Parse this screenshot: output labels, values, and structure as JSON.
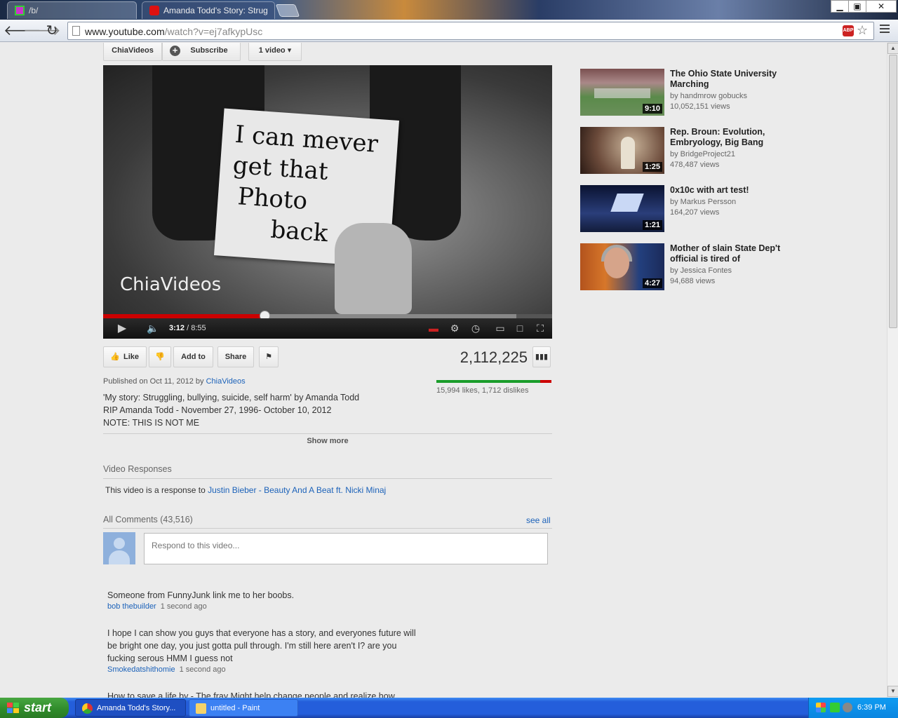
{
  "browser": {
    "tabs": [
      {
        "label": "/b/"
      },
      {
        "label": "Amanda Todd's Story: Strug"
      }
    ],
    "url_domain": "www.youtube.com",
    "url_path": "/watch?v=ej7afkypUsc",
    "window_buttons": {
      "minimize": "▁",
      "maximize": "▣",
      "close": "✕"
    }
  },
  "channel": {
    "name": "ChiaVideos",
    "subscribe_label": "Subscribe",
    "video_count_label": "1 video ▾"
  },
  "player": {
    "card_lines": [
      "I can mever",
      "get that",
      "Photo",
      "back"
    ],
    "watermark": "ChiaVideos",
    "current_time": "3:12",
    "duration": "/ 8:55",
    "played_fraction": 0.36,
    "buffered_fraction": 0.92
  },
  "actions": {
    "like_label": "Like",
    "add_to_label": "Add to",
    "share_label": "Share"
  },
  "stats": {
    "view_count": "2,112,225",
    "likes_text": "15,994 likes, 1,712 dislikes",
    "like_fraction": 0.903
  },
  "description": {
    "published_prefix": "Published on Oct 11, 2012 by",
    "published_by": "ChiaVideos",
    "lines": [
      "'My story: Struggling, bullying, suicide, self harm' by Amanda Todd",
      "RIP Amanda Todd - November 27, 1996- October 10, 2012",
      "NOTE: THIS IS NOT ME"
    ],
    "show_more_label": "Show more"
  },
  "responses": {
    "title": "Video Responses",
    "prefix": "This video is a response to",
    "link": "Justin Bieber - Beauty And A Beat ft. Nicki Minaj"
  },
  "comments": {
    "title": "All Comments (43,516)",
    "see_all_label": "see all",
    "input_placeholder": "Respond to this video...",
    "items": [
      {
        "text": "Someone from FunnyJunk link me to her boobs.",
        "author": "bob thebuilder",
        "time": "1 second ago"
      },
      {
        "text": "I hope I can show you guys that everyone has a story, and everyones future will be bright one day, you just gotta pull through. I'm still here aren't I? are you fucking serous HMM I guess not",
        "author": "Smokedatshithomie",
        "time": "1 second ago"
      },
      {
        "text": "How to save a life by - The fray Might help change people and realize how",
        "author": "",
        "time": ""
      }
    ]
  },
  "related": [
    {
      "title": "The Ohio State University Marching",
      "by": "by handmrow gobucks",
      "views": "10,052,151 views",
      "duration": "9:10"
    },
    {
      "title": "Rep. Broun: Evolution, Embryology, Big Bang",
      "by": "by BridgeProject21",
      "views": "478,487 views",
      "duration": "1:25"
    },
    {
      "title": "0x10c with art test!",
      "by": "by Markus Persson",
      "views": "164,207 views",
      "duration": "1:21"
    },
    {
      "title": "Mother of slain State Dep't official is tired of",
      "by": "by Jessica Fontes",
      "views": "94,688 views",
      "duration": "4:27"
    }
  ],
  "taskbar": {
    "start_label": "start",
    "tasks": [
      {
        "label": "Amanda Todd's Story..."
      },
      {
        "label": "untitled - Paint"
      }
    ],
    "clock": "6:39 PM"
  }
}
